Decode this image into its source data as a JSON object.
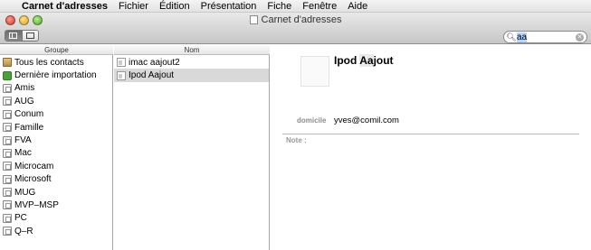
{
  "menu": {
    "app": "Carnet d'adresses",
    "items": [
      "Fichier",
      "Édition",
      "Présentation",
      "Fiche",
      "Fenêtre",
      "Aide"
    ]
  },
  "window": {
    "title": "Carnet d'adresses"
  },
  "search": {
    "value": "aa"
  },
  "columns": {
    "group_header": "Groupe",
    "name_header": "Nom"
  },
  "groups": [
    {
      "label": "Tous les contacts",
      "icon": "address-book-icon"
    },
    {
      "label": "Dernière importation",
      "icon": "import-icon"
    },
    {
      "label": "Amis",
      "icon": "group-icon"
    },
    {
      "label": "AUG",
      "icon": "group-icon"
    },
    {
      "label": "Conum",
      "icon": "group-icon"
    },
    {
      "label": "Famille",
      "icon": "group-icon"
    },
    {
      "label": "FVA",
      "icon": "group-icon"
    },
    {
      "label": "Mac",
      "icon": "group-icon"
    },
    {
      "label": "Microcam",
      "icon": "group-icon"
    },
    {
      "label": "Microsoft",
      "icon": "group-icon"
    },
    {
      "label": "MUG",
      "icon": "group-icon"
    },
    {
      "label": "MVP–MSP",
      "icon": "group-icon"
    },
    {
      "label": "PC",
      "icon": "group-icon"
    },
    {
      "label": "Q–R",
      "icon": "group-icon"
    }
  ],
  "names": [
    {
      "label": "imac aajout2",
      "selected": false
    },
    {
      "label": "Ipod Aajout",
      "selected": true
    }
  ],
  "card": {
    "name_prefix": "Ipod ",
    "name_highlight": "Aa",
    "name_suffix": "jout",
    "field_label": "domicile",
    "field_value": "yves@comil.com",
    "note_label": "Note :"
  }
}
